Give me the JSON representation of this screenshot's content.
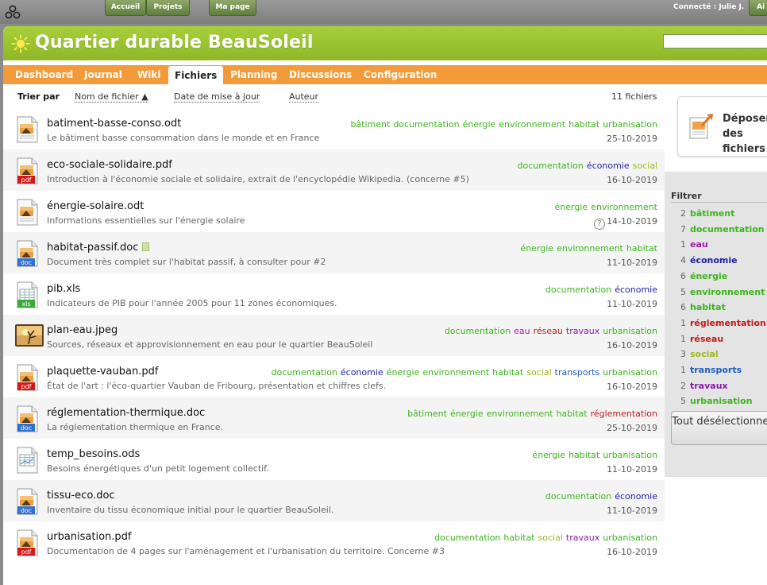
{
  "topbar": {
    "buttons": [
      "Accueil",
      "Projets",
      "Ma page",
      "Ai"
    ],
    "user": "Connecté : Julie J."
  },
  "project": {
    "title": "Quartier durable BeauSoleil",
    "header_color": "#9dc631",
    "nav_color": "#f39b3a"
  },
  "nav": {
    "tabs": [
      "Dashboard",
      "Journal",
      "Wiki",
      "Fichiers",
      "Planning",
      "Discussions",
      "Configuration"
    ],
    "active": "Fichiers"
  },
  "sort": {
    "label": "Trier par",
    "options": [
      "Nom de fichier ▲",
      "Date de mise à jour",
      "Auteur"
    ],
    "count": "11 fichiers"
  },
  "tag_colors": {
    "bâtiment": "#3cb51c",
    "documentation": "#3cb51c",
    "eau": "#a31aa8",
    "économie": "#1f1fa8",
    "énergie": "#3cb51c",
    "environnement": "#3cb51c",
    "habitat": "#3cb51c",
    "réglementation": "#c21a1a",
    "réseau": "#c21a1a",
    "social": "#9dba1a",
    "transports": "#1a5fc2",
    "travaux": "#8a1aa8",
    "urbanisation": "#3cb51c"
  },
  "files": [
    {
      "name": "batiment-basse-conso.odt",
      "desc": "Le bâtiment basse consommation dans le monde et en France",
      "tags": [
        "bâtiment",
        "documentation",
        "énergie",
        "environnement",
        "habitat",
        "urbanisation"
      ],
      "date": "25-10-2019",
      "icon": "odt-document-icon",
      "kind": "odt"
    },
    {
      "name": "eco-sociale-solidaire.pdf",
      "desc": "Introduction à l'économie sociale et solidaire, extrait de l'encyclopédie Wikipedia. (concerne #5)",
      "tags": [
        "documentation",
        "économie",
        "social"
      ],
      "date": "16-10-2019",
      "icon": "pdf-document-icon",
      "kind": "pdf"
    },
    {
      "name": "énergie-solaire.odt",
      "desc": "Informations essentielles sur l'énergie solaire",
      "tags": [
        "énergie",
        "environnement"
      ],
      "date": "14-10-2019",
      "icon": "odt-document-icon",
      "kind": "odt",
      "help": "?"
    },
    {
      "name": "habitat-passif.doc",
      "desc": "Document très complet sur l'habitat passif, à consulter pour #2",
      "tags": [
        "énergie",
        "environnement",
        "habitat"
      ],
      "date": "11-10-2019",
      "icon": "doc-document-icon",
      "kind": "doc",
      "attach": true
    },
    {
      "name": "pib.xls",
      "desc": "Indicateurs de PIB pour l'année 2005 pour 11 zones économiques.",
      "tags": [
        "documentation",
        "économie"
      ],
      "date": "11-10-2019",
      "icon": "xls-spreadsheet-icon",
      "kind": "xls"
    },
    {
      "name": "plan-eau.jpeg",
      "desc": "Sources, réseaux et approvisionnement en eau pour le quartier BeauSoleil",
      "tags": [
        "documentation",
        "eau",
        "réseau",
        "travaux",
        "urbanisation"
      ],
      "date": "16-10-2019",
      "icon": "image-thumbnail-icon",
      "kind": "img"
    },
    {
      "name": "plaquette-vauban.pdf",
      "desc": "État de l'art : l'éco-quartier Vauban de Fribourg, présentation et chiffres clefs.",
      "tags": [
        "documentation",
        "économie",
        "énergie",
        "environnement",
        "habitat",
        "social",
        "transports",
        "urbanisation"
      ],
      "date": "16-10-2019",
      "icon": "pdf-document-icon",
      "kind": "pdf"
    },
    {
      "name": "réglementation-thermique.doc",
      "desc": "La réglementation thermique en France.",
      "tags": [
        "bâtiment",
        "énergie",
        "environnement",
        "habitat",
        "réglementation"
      ],
      "date": "25-10-2019",
      "icon": "doc-document-icon",
      "kind": "doc"
    },
    {
      "name": "temp_besoins.ods",
      "desc": "Besoins énergétiques d'un petit logement collectif.",
      "tags": [
        "énergie",
        "habitat",
        "urbanisation"
      ],
      "date": "11-10-2019",
      "icon": "ods-spreadsheet-icon",
      "kind": "ods"
    },
    {
      "name": "tissu-eco.doc",
      "desc": "Inventaire du tissu économique initial pour le quartier BeauSoleil.",
      "tags": [
        "documentation",
        "économie"
      ],
      "date": "11-10-2019",
      "icon": "doc-document-icon",
      "kind": "doc"
    },
    {
      "name": "urbanisation.pdf",
      "desc": "Documentation de 4 pages sur l'aménagement et l'urbanisation du territoire. Concerne #3",
      "tags": [
        "documentation",
        "habitat",
        "social",
        "travaux",
        "urbanisation"
      ],
      "date": "16-10-2019",
      "icon": "pdf-document-icon",
      "kind": "pdf"
    }
  ],
  "sidebar": {
    "upload_label": "Déposer des fichiers",
    "filter_title": "Filtrer",
    "filters": [
      {
        "count": "2",
        "label": "bâtiment"
      },
      {
        "count": "7",
        "label": "documentation"
      },
      {
        "count": "1",
        "label": "eau"
      },
      {
        "count": "4",
        "label": "économie"
      },
      {
        "count": "6",
        "label": "énergie"
      },
      {
        "count": "5",
        "label": "environnement"
      },
      {
        "count": "6",
        "label": "habitat"
      },
      {
        "count": "1",
        "label": "réglementation"
      },
      {
        "count": "1",
        "label": "réseau"
      },
      {
        "count": "3",
        "label": "social"
      },
      {
        "count": "1",
        "label": "transports"
      },
      {
        "count": "2",
        "label": "travaux"
      },
      {
        "count": "5",
        "label": "urbanisation"
      }
    ],
    "deselect_label": "Tout désélectionner"
  }
}
